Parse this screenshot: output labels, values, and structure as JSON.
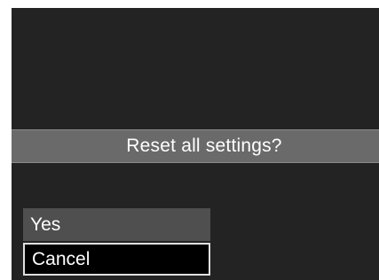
{
  "dialog": {
    "prompt": "Reset all settings?",
    "options": [
      {
        "label": "Yes",
        "selected": false
      },
      {
        "label": "Cancel",
        "selected": true
      }
    ]
  },
  "colors": {
    "background": "#232323",
    "prompt_bar": "#6a6a6a",
    "option_unselected": "#4f4f4f",
    "option_selected": "#000000",
    "selection_border": "#e0e0e0",
    "text": "#ffffff"
  }
}
